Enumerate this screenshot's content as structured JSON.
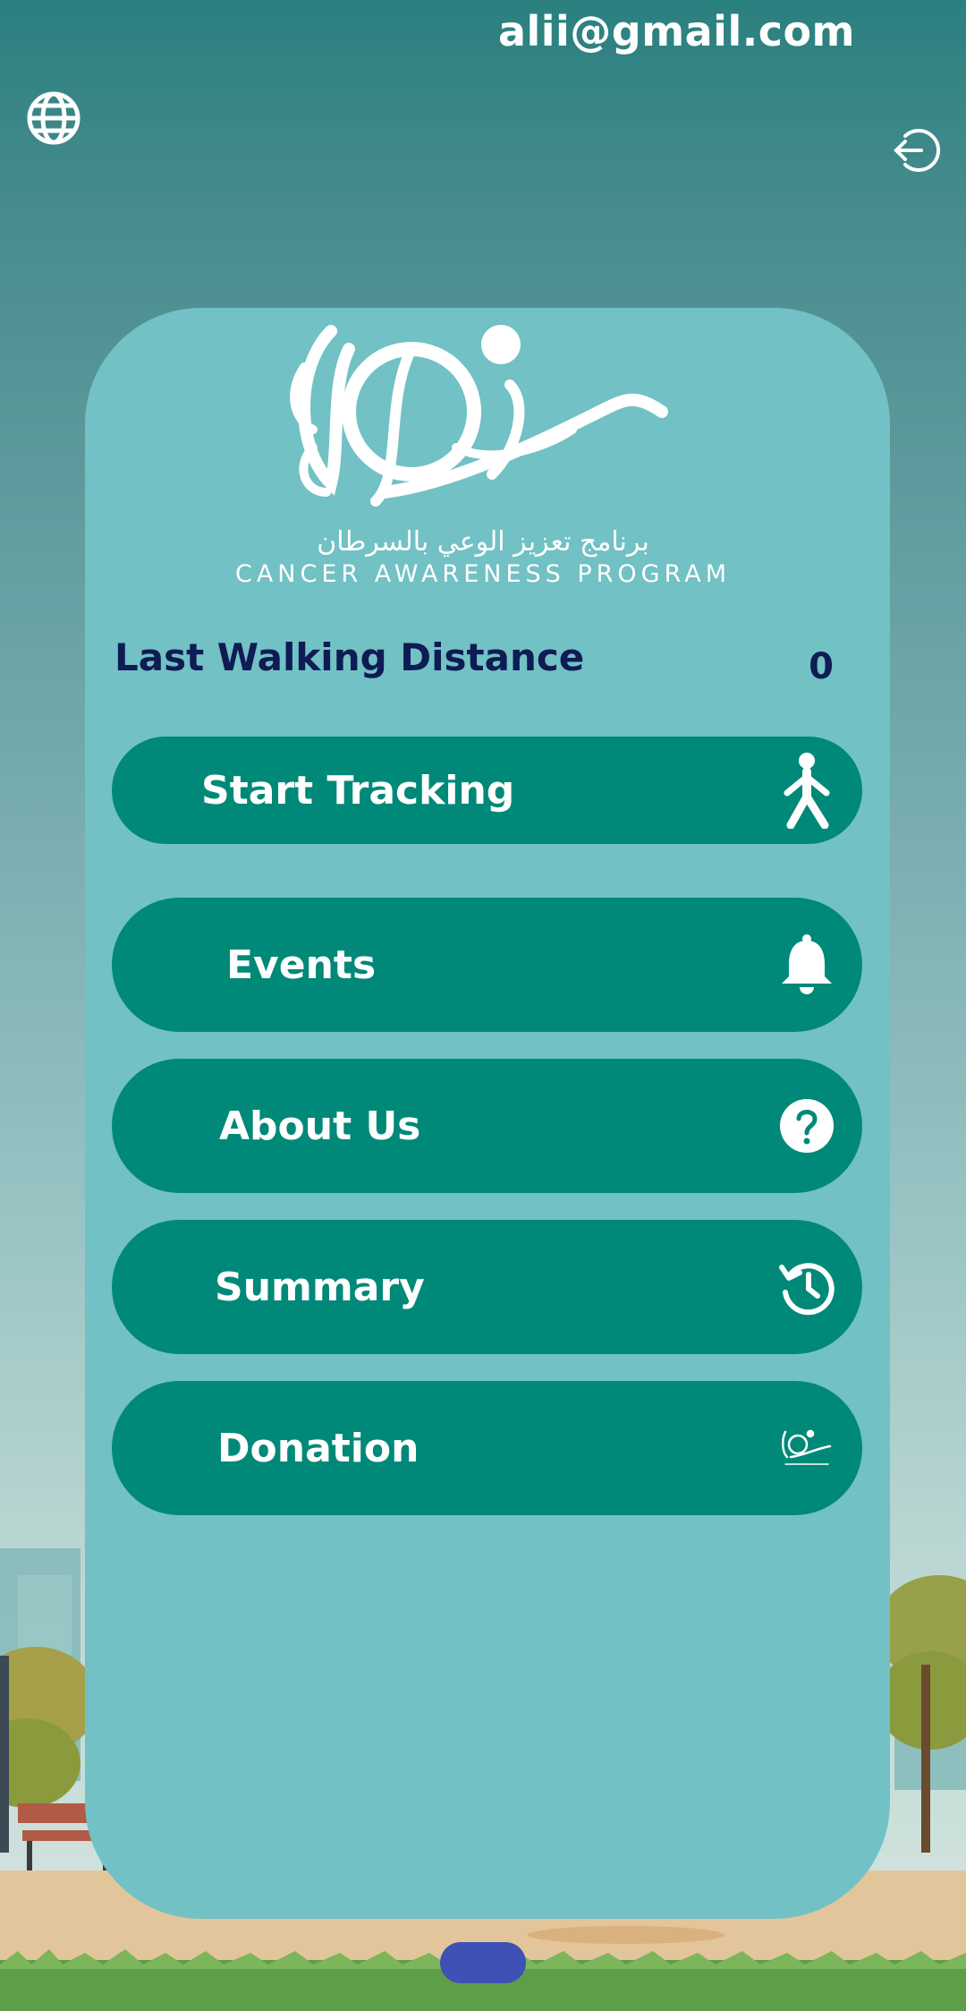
{
  "header": {
    "email": "alii@gmail.com",
    "language_icon": "globe-icon",
    "logout_icon": "logout-icon"
  },
  "logo": {
    "arabic": "برنامج تعزيز الوعي بالسرطان",
    "english": "CANCER AWARENESS PROGRAM"
  },
  "distance": {
    "label": "Last Walking Distance",
    "value": "0"
  },
  "menu": {
    "start_tracking": {
      "label": "Start Tracking",
      "icon": "walking-person-icon"
    },
    "events": {
      "label": "Events",
      "icon": "bell-icon"
    },
    "about": {
      "label": "About Us",
      "icon": "question-circle-icon"
    },
    "summary": {
      "label": "Summary",
      "icon": "history-icon"
    },
    "donation": {
      "label": "Donation",
      "icon": "program-logo-icon"
    }
  },
  "colors": {
    "button_bg": "#008978",
    "card_bg": "#72c1c4",
    "distance_text": "#0f1b54",
    "home_pill": "#3f51b5"
  }
}
